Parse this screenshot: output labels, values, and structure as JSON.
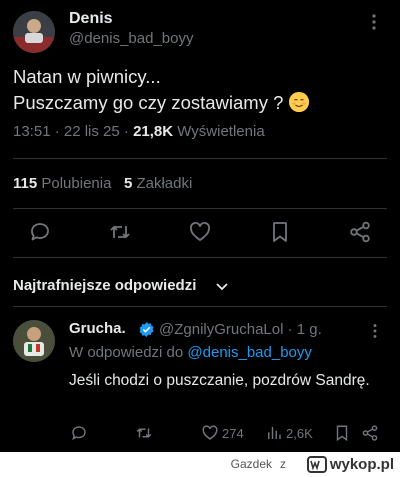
{
  "tweet": {
    "author_name": "Denis",
    "author_handle": "@denis_bad_boyy",
    "text_line1": "Natan w piwnicy...",
    "text_line2": "Puszczamy go czy zostawiamy ?",
    "emoji_icon": "smiling-face-emoji",
    "time": "13:51 · 22 lis 25 · ",
    "views_count": "21,8K",
    "views_label": " Wyświetlenia",
    "likes_count": "115",
    "likes_label": "Polubienia",
    "bookmarks_count": "5",
    "bookmarks_label": "Zakładki"
  },
  "actions": [
    "reply-icon",
    "retweet-icon",
    "like-icon",
    "bookmark-icon",
    "share-icon"
  ],
  "replies_section": {
    "title": "Najtrafniejsze odpowiedzi"
  },
  "reply": {
    "author_name": "Grucha.",
    "author_handle": "@ZgnilyGruchaLol · 1 g.",
    "reply_to_prefix": "W odpowiedzi do ",
    "reply_to_handle": "@denis_bad_boyy",
    "text": "Jeśli chodzi o puszczanie, pozdrów Sandrę.",
    "likes": "274",
    "views": "2,6K"
  },
  "footer": {
    "username": "Gazdek",
    "connector": "z",
    "site": "wykop.pl"
  },
  "colors": {
    "background": "#000000",
    "text": "#e7e9ea",
    "muted": "#71767b",
    "link": "#1d9bf0",
    "verified": "#1d9bf0"
  }
}
